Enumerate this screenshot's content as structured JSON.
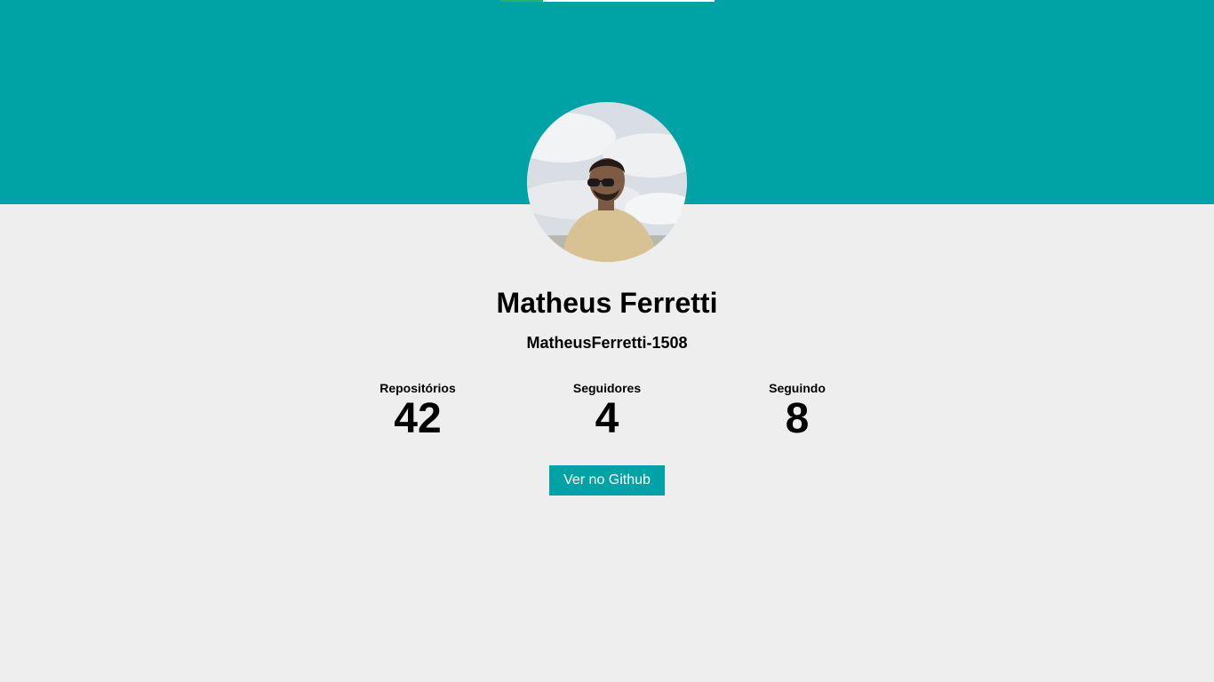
{
  "colors": {
    "accent": "#00a3a5",
    "background": "#eeeeee",
    "loading_bar": "#23b26b"
  },
  "loading_bar": {
    "progress": 0.2
  },
  "profile": {
    "name": "Matheus Ferretti",
    "login": "MatheusFerretti-1508",
    "avatar_icon": "user-photo"
  },
  "stats": {
    "repos_label": "Repositórios",
    "repos_value": "42",
    "followers_label": "Seguidores",
    "followers_value": "4",
    "following_label": "Seguindo",
    "following_value": "8"
  },
  "actions": {
    "github_button": "Ver no Github"
  }
}
